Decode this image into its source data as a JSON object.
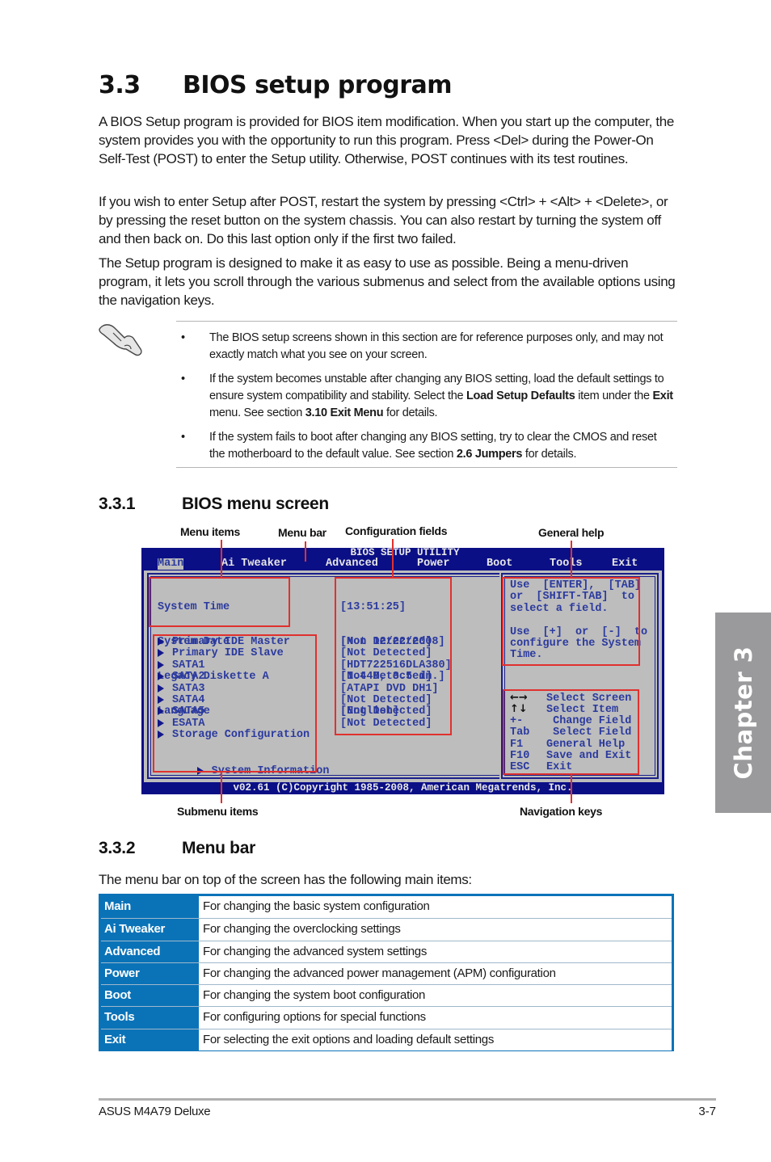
{
  "section": {
    "number": "3.3",
    "title": "BIOS setup program",
    "paragraphs": [
      "A BIOS Setup program is provided for BIOS item modification. When you start up the computer, the system provides you with the opportunity to run this program. Press <Del> during the Power-On Self-Test (POST) to enter the Setup utility. Otherwise, POST continues with its test routines.",
      "If you wish to enter Setup after POST, restart the system by pressing <Ctrl> + <Alt> + <Delete>, or by pressing the reset button on the system chassis. You can also restart by turning the system off and then back on. Do this last option only if the first two failed.",
      "The Setup program is designed to make it as easy to use as possible. Being a menu-driven program, it lets you scroll through the various submenus and select from the available options using the navigation keys."
    ]
  },
  "note": {
    "icon": "hand-pointer-icon",
    "bullet": "•",
    "items": [
      {
        "parts": [
          {
            "t": "The BIOS setup screens shown in this section are for reference purposes only, and may not exactly match what you see on your screen.",
            "b": false
          }
        ]
      },
      {
        "parts": [
          {
            "t": "If the system becomes unstable after changing any BIOS setting, load the default settings to ensure system compatibility and stability. Select the ",
            "b": false
          },
          {
            "t": "Load Setup Defaults",
            "b": true
          },
          {
            "t": " item under the ",
            "b": false
          },
          {
            "t": "Exit",
            "b": true
          },
          {
            "t": " menu. See section ",
            "b": false
          },
          {
            "t": "3.10 Exit Menu",
            "b": true
          },
          {
            "t": " for details.",
            "b": false
          }
        ]
      },
      {
        "parts": [
          {
            "t": "If the system fails to boot after changing any BIOS setting, try to clear the CMOS and reset the motherboard to the default value. See section ",
            "b": false
          },
          {
            "t": "2.6 Jumpers",
            "b": true
          },
          {
            "t": " for details.",
            "b": false
          }
        ]
      }
    ]
  },
  "subsection1": {
    "number": "3.3.1",
    "title": "BIOS menu screen"
  },
  "callouts": {
    "menu_items": "Menu items",
    "menu_bar": "Menu bar",
    "config_fields": "Configuration fields",
    "general_help": "General help",
    "submenu_items": "Submenu items",
    "navigation_keys": "Navigation keys"
  },
  "bios": {
    "title": "BIOS SETUP UTILITY",
    "tabs": [
      "Main",
      "Ai Tweaker",
      "Advanced",
      "Power",
      "Boot",
      "Tools",
      "Exit"
    ],
    "active_tab": "Main",
    "menu_items": [
      "System Time",
      "System Date",
      "Legacy Diskette A",
      "Language"
    ],
    "menu_values": [
      "[13:51:25]",
      "[Mon 12/22/2008]",
      "[1.44M, 3.5 in.]",
      "[English]"
    ],
    "submenu_items": [
      "Primary IDE Master",
      "Primary IDE Slave",
      "SATA1",
      "SATA2",
      "SATA3",
      "SATA4",
      "SATA5",
      "ESATA",
      "Storage Configuration"
    ],
    "system_information": "System Information",
    "submenu_values": [
      "[Not Detected]",
      "[Not Detected]",
      "[HDT722516DLA380]",
      "[Not Detected]",
      "[ATAPI DVD DH1]",
      "[Not Detected]",
      "[Not Detected]",
      "[Not Detected]"
    ],
    "help_lines": [
      "Use  [ENTER],  [TAB]",
      "or  [SHIFT-TAB]  to",
      "select a field.",
      "",
      "Use  [+]  or  [-]  to",
      "configure the System",
      "Time."
    ],
    "nav_keys": [
      {
        "key": "←→",
        "action": "Select Screen",
        "icon": "left-right-arrows-icon"
      },
      {
        "key": "↑↓",
        "action": "Select Item",
        "icon": "up-down-arrows-icon"
      },
      {
        "key": "+-",
        "action": " Change Field"
      },
      {
        "key": "Tab",
        "action": " Select Field"
      },
      {
        "key": "F1",
        "action": "General Help"
      },
      {
        "key": "F10",
        "action": "Save and Exit"
      },
      {
        "key": "ESC",
        "action": "Exit"
      }
    ],
    "footer": "v02.61 (C)Copyright 1985-2008, American Megatrends, Inc."
  },
  "subsection2": {
    "number": "3.3.2",
    "title": "Menu bar"
  },
  "menubar_intro": "The menu bar on top of the screen has the following main items:",
  "menubar_table": [
    {
      "item": "Main",
      "desc": "For changing the basic system configuration"
    },
    {
      "item": "Ai Tweaker",
      "desc": "For changing the overclocking settings"
    },
    {
      "item": "Advanced",
      "desc": "For changing the advanced system settings"
    },
    {
      "item": "Power",
      "desc": "For changing the advanced power management (APM) configuration"
    },
    {
      "item": "Boot",
      "desc": "For changing the system boot configuration"
    },
    {
      "item": "Tools",
      "desc": "For configuring options for special functions"
    },
    {
      "item": "Exit",
      "desc": "For selecting the exit options and loading default settings"
    }
  ],
  "chapter_tab": "Chapter 3",
  "footer": {
    "left": "ASUS M4A79 Deluxe",
    "right": "3-7"
  },
  "colors": {
    "bios_blue": "#0b0f86",
    "bios_gray": "#bdbdbd",
    "bios_text": "#2b3a9e",
    "callout_red": "#e0312e",
    "table_blue": "#0a73b8",
    "chapter_gray": "#9a9a9c"
  }
}
